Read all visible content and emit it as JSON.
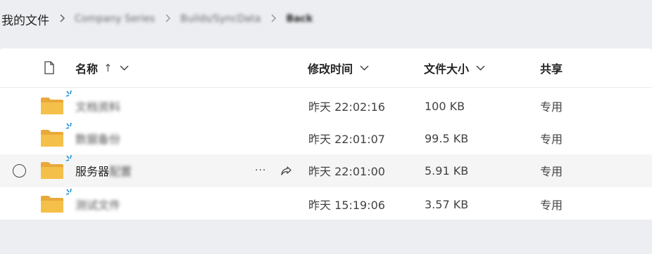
{
  "breadcrumb": {
    "root": "我的文件",
    "seg1": "Company Series",
    "seg2": "Builds/SyncData",
    "seg3": "Back",
    "separator": ">"
  },
  "table": {
    "columns": {
      "name": "名称",
      "sort_indicator": "↑",
      "modified": "修改时间",
      "size": "文件大小",
      "sharing": "共享"
    },
    "rows": [
      {
        "name_clear": "",
        "name_blur": "文档资料",
        "modified": "昨天 22:02:16",
        "size": "100 KB",
        "sharing": "专用"
      },
      {
        "name_clear": "",
        "name_blur": "数据备份",
        "modified": "昨天 22:01:07",
        "size": "99.5 KB",
        "sharing": "专用"
      },
      {
        "name_clear": "服务器",
        "name_blur": "配置",
        "modified": "昨天 22:01:00",
        "size": "5.91 KB",
        "sharing": "专用"
      },
      {
        "name_clear": "",
        "name_blur": "测试文件",
        "modified": "昨天 15:19:06",
        "size": "3.57 KB",
        "sharing": "专用"
      }
    ],
    "more_label": "···"
  },
  "colors": {
    "folder": "#f5c04a",
    "folder_back": "#e8a93a",
    "new_marker": "#1a8fd6",
    "hover_row": "#f5f5f5"
  },
  "icons": [
    "chevron-right-icon",
    "document-icon",
    "chevron-down-icon",
    "folder-icon",
    "new-item-sparkle-icon",
    "more-icon",
    "share-icon",
    "radio-select-icon"
  ]
}
